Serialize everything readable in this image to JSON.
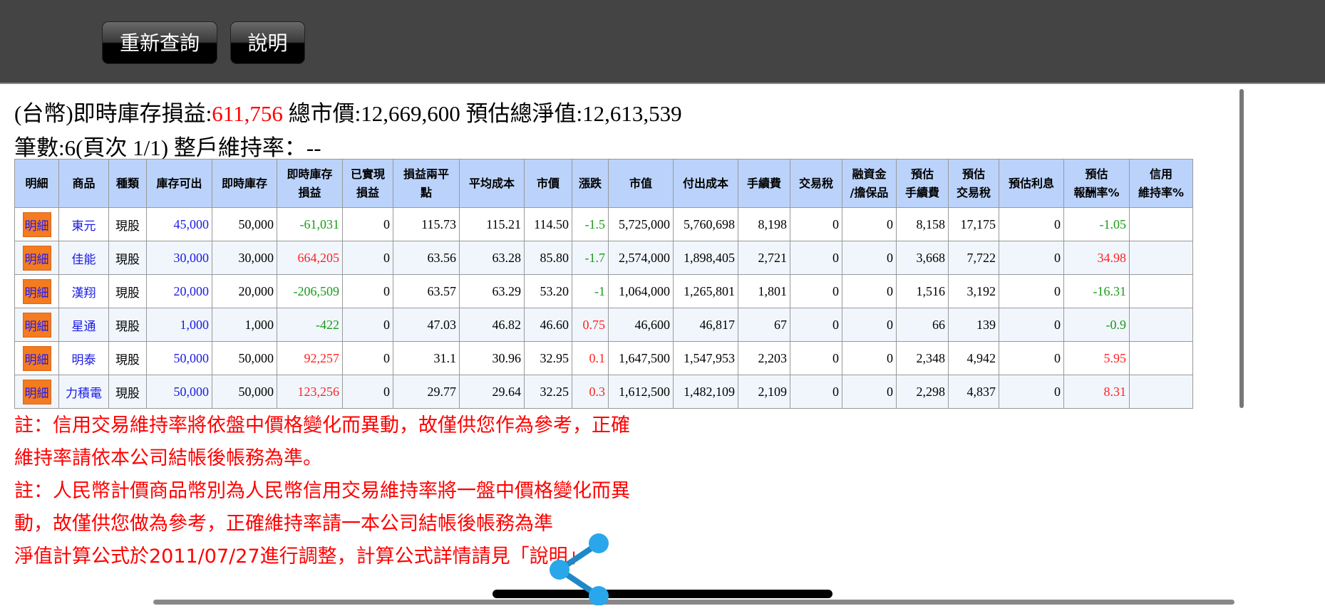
{
  "toolbar": {
    "requery": "重新查詢",
    "help": "說明"
  },
  "summary": {
    "pl_label": "(台幣)即時庫存損益:",
    "pl_value": "611,756",
    "mv_label": " 總市價:12,669,600",
    "nav_label": " 預估總淨值:12,613,539",
    "line2": "筆數:6(頁次 1/1) 整戶維持率：--"
  },
  "table": {
    "headers": [
      "明細",
      "商品",
      "種類",
      "庫存可出",
      "即時庫存",
      "即時庫存\n損益",
      "已實現\n損益",
      "損益兩平\n點",
      "平均成本",
      "市價",
      "漲跌",
      "市值",
      "付出成本",
      "手續費",
      "交易稅",
      "融資金\n/擔保品",
      "預估\n手續費",
      "預估\n交易稅",
      "預估利息",
      "預估\n報酬率%",
      "信用\n維持率%"
    ],
    "detail_label": "明細",
    "rows": [
      {
        "name": "東元",
        "type": "現股",
        "avail": "45,000",
        "qty": "50,000",
        "pl": "-61,031",
        "pl_c": "g",
        "realized": "0",
        "be": "115.73",
        "avg": "115.21",
        "price": "114.50",
        "chg": "-1.5",
        "chg_c": "g",
        "mv": "5,725,000",
        "cost": "5,760,698",
        "fee": "8,198",
        "tax": "0",
        "margin": "0",
        "efee": "8,158",
        "etax": "17,175",
        "int": "0",
        "ret": "-1.05",
        "ret_c": "g",
        "credit": ""
      },
      {
        "name": "佳能",
        "type": "現股",
        "avail": "30,000",
        "qty": "30,000",
        "pl": "664,205",
        "pl_c": "r",
        "realized": "0",
        "be": "63.56",
        "avg": "63.28",
        "price": "85.80",
        "chg": "-1.7",
        "chg_c": "g",
        "mv": "2,574,000",
        "cost": "1,898,405",
        "fee": "2,721",
        "tax": "0",
        "margin": "0",
        "efee": "3,668",
        "etax": "7,722",
        "int": "0",
        "ret": "34.98",
        "ret_c": "r",
        "credit": ""
      },
      {
        "name": "漢翔",
        "type": "現股",
        "avail": "20,000",
        "qty": "20,000",
        "pl": "-206,509",
        "pl_c": "g",
        "realized": "0",
        "be": "63.57",
        "avg": "63.29",
        "price": "53.20",
        "chg": "-1",
        "chg_c": "g",
        "mv": "1,064,000",
        "cost": "1,265,801",
        "fee": "1,801",
        "tax": "0",
        "margin": "0",
        "efee": "1,516",
        "etax": "3,192",
        "int": "0",
        "ret": "-16.31",
        "ret_c": "g",
        "credit": ""
      },
      {
        "name": "星通",
        "type": "現股",
        "avail": "1,000",
        "qty": "1,000",
        "pl": "-422",
        "pl_c": "g",
        "realized": "0",
        "be": "47.03",
        "avg": "46.82",
        "price": "46.60",
        "chg": "0.75",
        "chg_c": "r",
        "mv": "46,600",
        "cost": "46,817",
        "fee": "67",
        "tax": "0",
        "margin": "0",
        "efee": "66",
        "etax": "139",
        "int": "0",
        "ret": "-0.9",
        "ret_c": "g",
        "credit": ""
      },
      {
        "name": "明泰",
        "type": "現股",
        "avail": "50,000",
        "qty": "50,000",
        "pl": "92,257",
        "pl_c": "r",
        "realized": "0",
        "be": "31.1",
        "avg": "30.96",
        "price": "32.95",
        "chg": "0.1",
        "chg_c": "r",
        "mv": "1,647,500",
        "cost": "1,547,953",
        "fee": "2,203",
        "tax": "0",
        "margin": "0",
        "efee": "2,348",
        "etax": "4,942",
        "int": "0",
        "ret": "5.95",
        "ret_c": "r",
        "credit": ""
      },
      {
        "name": "力積電",
        "type": "現股",
        "avail": "50,000",
        "qty": "50,000",
        "pl": "123,256",
        "pl_c": "r",
        "realized": "0",
        "be": "29.77",
        "avg": "29.64",
        "price": "32.25",
        "chg": "0.3",
        "chg_c": "r",
        "mv": "1,612,500",
        "cost": "1,482,109",
        "fee": "2,109",
        "tax": "0",
        "margin": "0",
        "efee": "2,298",
        "etax": "4,837",
        "int": "0",
        "ret": "8.31",
        "ret_c": "r",
        "credit": ""
      }
    ]
  },
  "notes": [
    "註：信用交易維持率將依盤中價格變化而異動，故僅供您作為參考，正確維持率請依本公司結帳後帳務為準。",
    "註：人民幣計價商品幣別為人民幣信用交易維持率將一盤中價格變化而異動，故僅供您做為參考，正確維持率請一本公司結帳後帳務為準",
    "淨值計算公式於2011/07/27進行調整，計算公式詳情請見「說明」"
  ],
  "colors": {
    "header_bg": "#444444",
    "table_header": "#bbd3fb",
    "detail_btn": "#f47b20",
    "positive": "#ff2222",
    "negative": "#1a9a1a"
  }
}
